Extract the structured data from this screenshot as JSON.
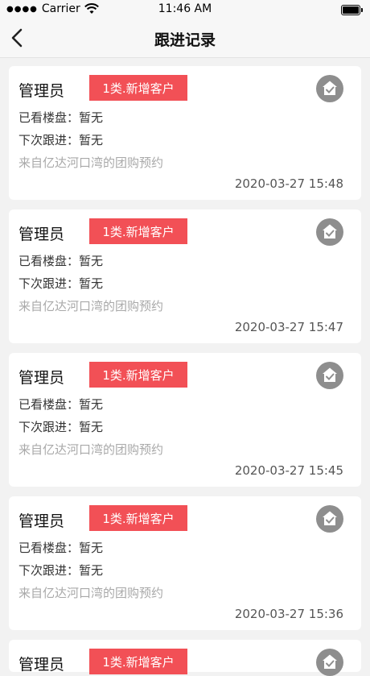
{
  "status_bar": {
    "carrier": "Carrier",
    "time": "11:46 AM"
  },
  "nav": {
    "title": "跟进记录",
    "back_icon": "chevron-left-icon"
  },
  "colors": {
    "tag_bg": "#f25056",
    "icon_gray": "#8e8e8e"
  },
  "records": [
    {
      "name": "管理员",
      "tag": "1类.新增客户",
      "viewed": "已看楼盘：暂无",
      "next_follow": "下次跟进：暂无",
      "source": "来自亿达河口湾的团购预约",
      "time": "2020-03-27 15:48"
    },
    {
      "name": "管理员",
      "tag": "1类.新增客户",
      "viewed": "已看楼盘：暂无",
      "next_follow": "下次跟进：暂无",
      "source": "来自亿达河口湾的团购预约",
      "time": "2020-03-27 15:47"
    },
    {
      "name": "管理员",
      "tag": "1类.新增客户",
      "viewed": "已看楼盘：暂无",
      "next_follow": "下次跟进：暂无",
      "source": "来自亿达河口湾的团购预约",
      "time": "2020-03-27 15:45"
    },
    {
      "name": "管理员",
      "tag": "1类.新增客户",
      "viewed": "已看楼盘：暂无",
      "next_follow": "下次跟进：暂无",
      "source": "来自亿达河口湾的团购预约",
      "time": "2020-03-27 15:36"
    },
    {
      "name": "管理员",
      "tag": "1类.新增客户",
      "viewed": "",
      "next_follow": "",
      "source": "",
      "time": ""
    }
  ]
}
